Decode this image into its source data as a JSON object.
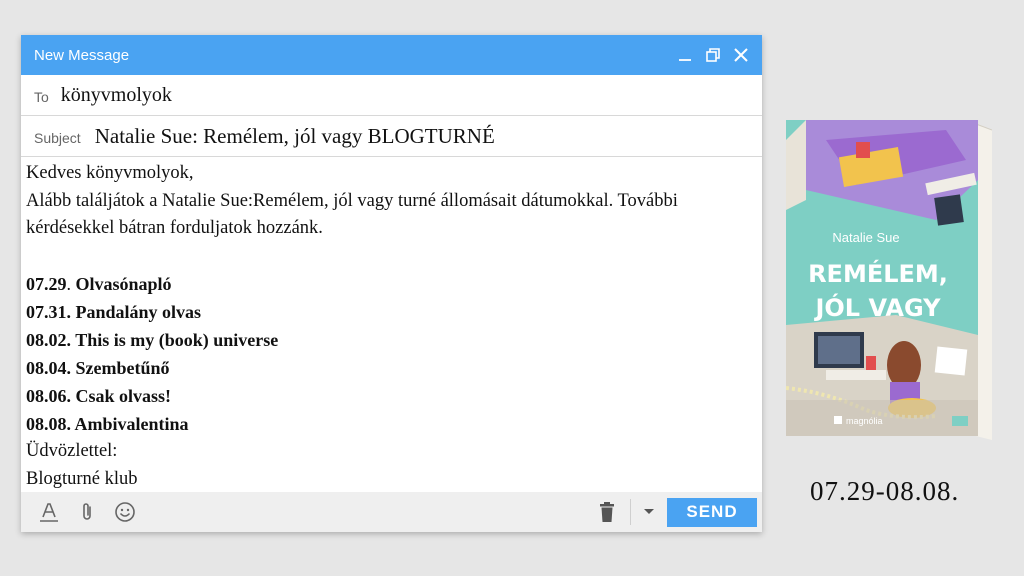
{
  "window": {
    "title": "New Message",
    "to_label": "To",
    "to_value": "könyvmolyok",
    "subject_label": "Subject",
    "subject_value": "Natalie Sue: Remélem, jól vagy BLOGTURNÉ"
  },
  "body": {
    "greeting": "Kedves könyvmolyok,",
    "intro": "Alább találjátok a Natalie Sue:Remélem, jól vagy turné állomásait dátumokkal. További kérdésekkel bátran forduljatok hozzánk.",
    "stops": [
      {
        "date": "07.29",
        "sep": ". ",
        "name": "Olvasónapló"
      },
      {
        "date": "07.31.",
        "sep": " ",
        "name": "Pandalány olvas"
      },
      {
        "date": "08.02.",
        "sep": " ",
        "name": "This is my (book) universe"
      },
      {
        "date": "08.04.",
        "sep": " ",
        "name": "Szembetűnő"
      },
      {
        "date": "08.06.",
        "sep": " ",
        "name": "Csak olvass!"
      },
      {
        "date": "08.08.",
        "sep": " ",
        "name": "Ambivalentina"
      }
    ],
    "closing": "Üdvözlettel:",
    "signature": "Blogturné klub"
  },
  "footer": {
    "send_label": "SEND",
    "icons": [
      "format-text-icon",
      "attach-icon",
      "emoji-icon",
      "trash-icon",
      "caret-down-icon"
    ]
  },
  "book": {
    "author": "Natalie Sue",
    "title_line1": "REMÉLEM,",
    "title_line2": "JÓL VAGY",
    "publisher": "magnólia",
    "colors": {
      "cover": "#7ecfc4",
      "purple": "#9b6ad0",
      "floor": "#d9d3c7"
    }
  },
  "date_range": "07.29-08.08."
}
